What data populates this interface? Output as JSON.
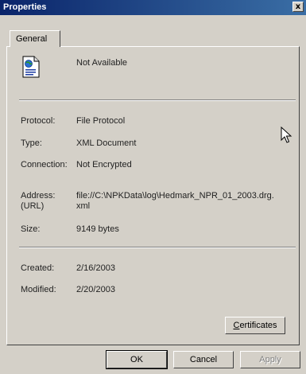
{
  "window": {
    "title": "Properties",
    "close_glyph": "x"
  },
  "tabs": [
    {
      "label": "General"
    }
  ],
  "file": {
    "name": "Not Available",
    "icon": "xml-document-icon"
  },
  "info": {
    "protocol_label": "Protocol:",
    "protocol": "File Protocol",
    "type_label": "Type:",
    "type": "XML Document",
    "connection_label": "Connection:",
    "connection": "Not Encrypted",
    "address_label_1": "Address:",
    "address_label_2": "(URL)",
    "address_line_1": "file://C:\\NPKData\\log\\Hedmark_NPR_01_2003.drg.",
    "address_line_2": "xml",
    "size_label": "Size:",
    "size": "9149 bytes",
    "created_label": "Created:",
    "created": "2/16/2003",
    "modified_label": "Modified:",
    "modified": "2/20/2003"
  },
  "buttons": {
    "certificates_prefix": "",
    "certificates_underline": "C",
    "certificates_rest": "ertificates",
    "ok": "OK",
    "cancel": "Cancel",
    "apply": "Apply"
  },
  "colors": {
    "titlebar_start": "#0a246a",
    "titlebar_end": "#3a6ea5",
    "face": "#d4d0c8"
  }
}
